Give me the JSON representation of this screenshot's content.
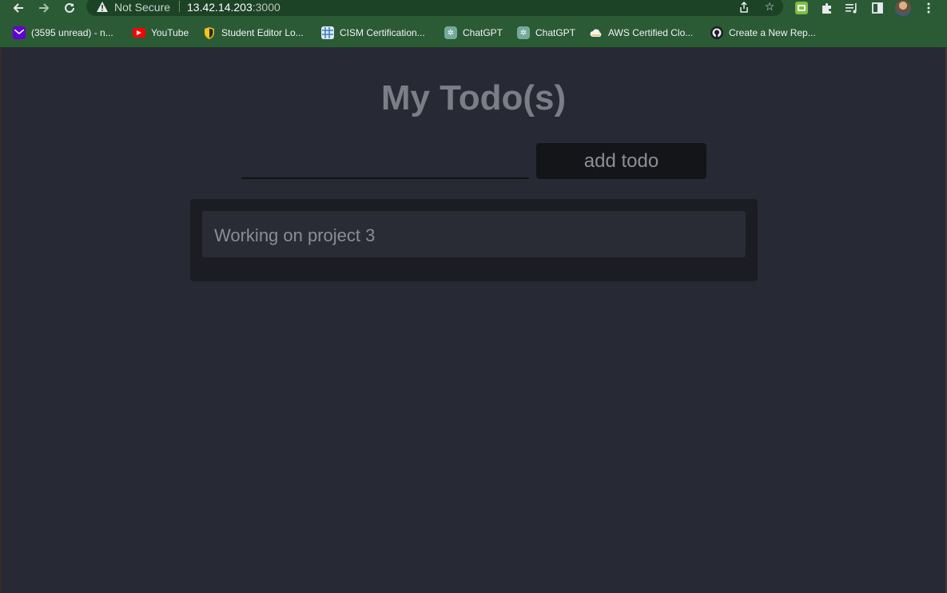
{
  "browser": {
    "security_label": "Not Secure",
    "url_host": "13.42.14.203",
    "url_port": ":3000",
    "nav": {
      "back_icon": "arrow-left-icon",
      "forward_icon": "arrow-right-icon",
      "reload_icon": "reload-icon"
    }
  },
  "bookmarks": [
    {
      "label": "(3595 unread) - n...",
      "icon": "yahoo-mail-icon",
      "color": "#6001d2"
    },
    {
      "label": "YouTube",
      "icon": "youtube-icon",
      "color": "#ff0000"
    },
    {
      "label": "Student Editor Lo...",
      "icon": "shield-icon",
      "color": "#2f3a2e"
    },
    {
      "label": "CISM Certification...",
      "icon": "grid-icon",
      "color": "#5aa0d8"
    },
    {
      "label": "ChatGPT",
      "icon": "chatgpt-icon",
      "color": "#74aa9c"
    },
    {
      "label": "ChatGPT",
      "icon": "chatgpt-icon",
      "color": "#74aa9c"
    },
    {
      "label": "AWS Certified Clo...",
      "icon": "cloud-icon",
      "color": "#f4f4f4"
    },
    {
      "label": "Create a New Rep...",
      "icon": "github-icon",
      "color": "#1b1f23"
    }
  ],
  "app": {
    "title": "My Todo(s)",
    "input_value": "",
    "add_button_label": "add todo",
    "todos": [
      {
        "text": "Working on project 3"
      }
    ]
  },
  "colors": {
    "chrome": "#2b5b34",
    "page_background": "#272a34",
    "list_background": "#1b1d22",
    "item_background": "#292c35",
    "button_background": "#141518"
  }
}
